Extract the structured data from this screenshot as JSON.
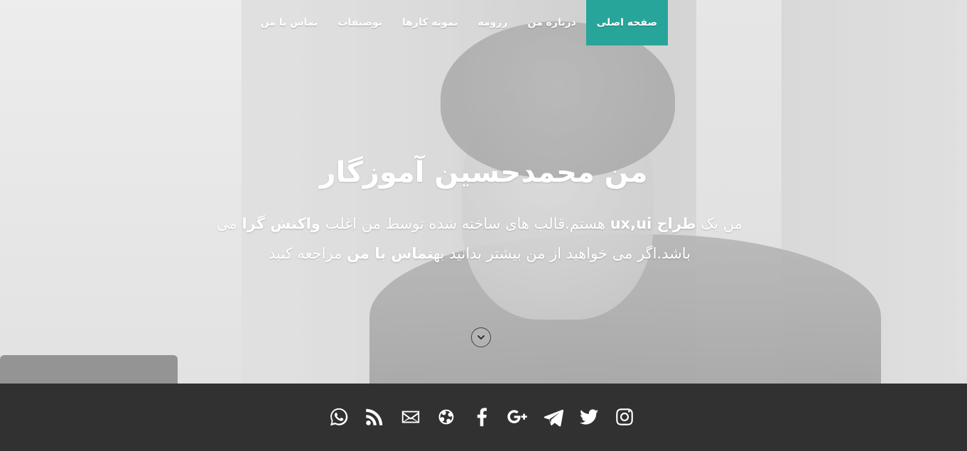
{
  "nav": {
    "items": [
      {
        "label": "صفحه اصلی",
        "active": true
      },
      {
        "label": "درباره من",
        "active": false
      },
      {
        "label": "رزومه",
        "active": false
      },
      {
        "label": "نمونه کارها",
        "active": false
      },
      {
        "label": "توصیفات",
        "active": false
      },
      {
        "label": "تماس با من",
        "active": false
      }
    ],
    "accent_color": "#27a59a"
  },
  "hero": {
    "title": "من محمدحسین آموزگار",
    "desc": {
      "p1": "من یک ",
      "b1": "طراح ux,ui",
      "p2": " هستم.قالب های ساخته شده توسط من اغلب ",
      "b2": "واکنش گرا",
      "p3": " می باشد.اگر می خواهید از من بیشتر بدانید به",
      "b3": "تماس با من",
      "p4": " مراجعه کنید"
    },
    "scroll_icon": "chevron-down-icon"
  },
  "social": {
    "icons": [
      "whatsapp-icon",
      "rss-icon",
      "email-icon",
      "aparat-icon",
      "facebook-icon",
      "google-plus-icon",
      "telegram-icon",
      "twitter-icon",
      "instagram-icon"
    ]
  }
}
